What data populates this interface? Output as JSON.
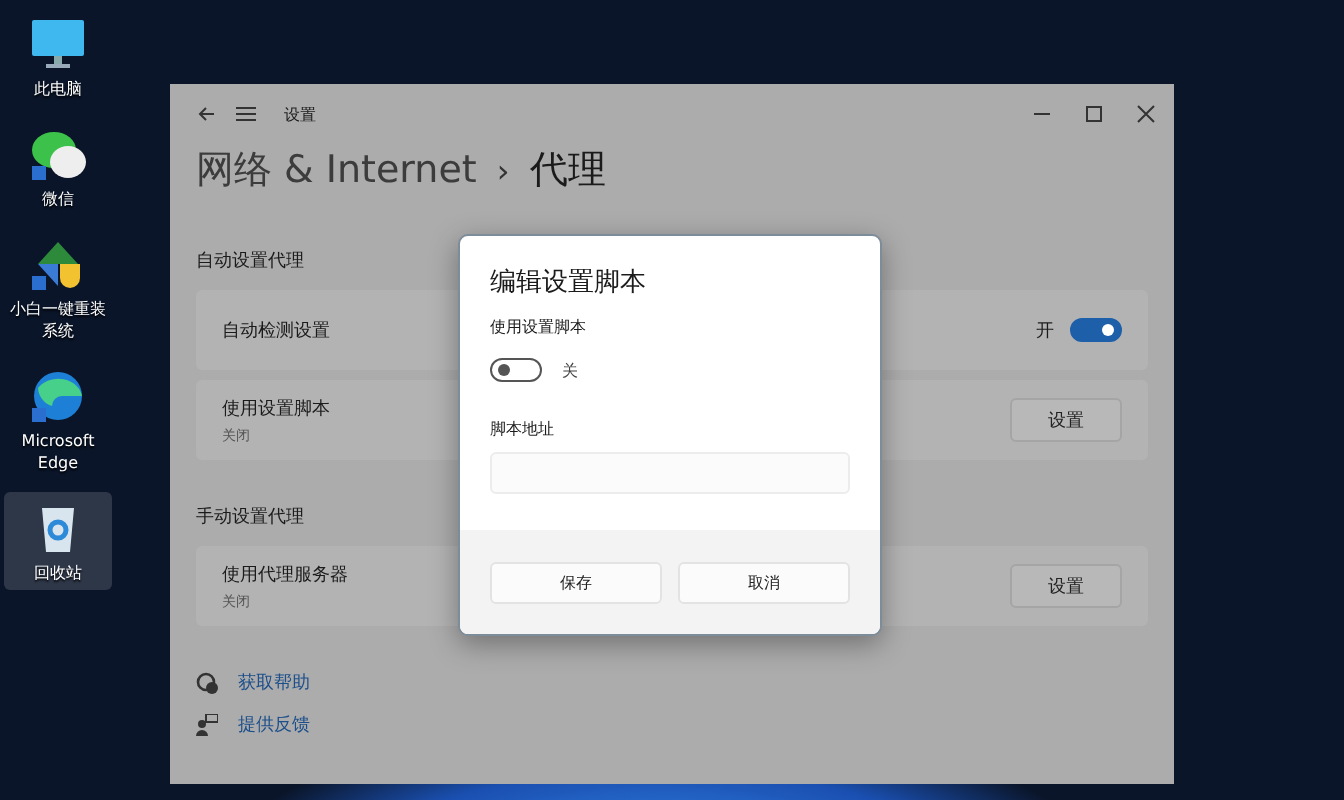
{
  "desktop_icons": [
    {
      "kind": "computer",
      "label": "此电脑",
      "selected": false
    },
    {
      "kind": "chat",
      "label": "微信",
      "selected": false
    },
    {
      "kind": "installer",
      "label": "小白一键重装系统",
      "selected": false
    },
    {
      "kind": "edge",
      "label": "Microsoft Edge",
      "selected": false
    },
    {
      "kind": "recycle",
      "label": "回收站",
      "selected": true
    }
  ],
  "window": {
    "app_title": "设置",
    "breadcrumb_parent": "网络 & Internet",
    "breadcrumb_separator": "›",
    "page_title": "代理",
    "sections": [
      {
        "heading": "自动设置代理",
        "rows": [
          {
            "kind": "toggle",
            "label": "自动检测设置",
            "state_label": "开",
            "on": true
          },
          {
            "kind": "button",
            "label": "使用设置脚本",
            "sublabel": "关闭",
            "button": "设置"
          }
        ]
      },
      {
        "heading": "手动设置代理",
        "rows": [
          {
            "kind": "button",
            "label": "使用代理服务器",
            "sublabel": "关闭",
            "button": "设置"
          }
        ]
      }
    ],
    "links": [
      {
        "kind": "help",
        "label": "获取帮助"
      },
      {
        "kind": "feedback",
        "label": "提供反馈"
      }
    ]
  },
  "dialog": {
    "title": "编辑设置脚本",
    "toggle_label": "使用设置脚本",
    "toggle_state_label": "关",
    "on": false,
    "field_label": "脚本地址",
    "buttons": [
      "保存",
      "取消"
    ]
  }
}
